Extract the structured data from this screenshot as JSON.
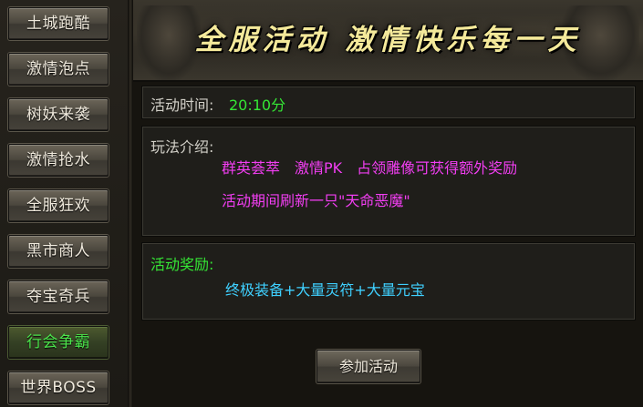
{
  "menu": {
    "items": [
      {
        "label": "土城跑酷",
        "active": false
      },
      {
        "label": "激情泡点",
        "active": false
      },
      {
        "label": "树妖来袭",
        "active": false
      },
      {
        "label": "激情抢水",
        "active": false
      },
      {
        "label": "全服狂欢",
        "active": false
      },
      {
        "label": "黑市商人",
        "active": false
      },
      {
        "label": "夺宝奇兵",
        "active": false
      },
      {
        "label": "行会争霸",
        "active": true
      },
      {
        "label": "世界BOSS",
        "active": false
      }
    ]
  },
  "banner": {
    "title": "全服活动 激情快乐每一天"
  },
  "activity_time": {
    "label": "活动时间:",
    "value": "20:10分"
  },
  "gameplay_intro": {
    "label": "玩法介绍:",
    "line1": "群英荟萃　激情PK　占领雕像可获得额外奖励",
    "line2": "活动期间刷新一只\"天命恶魔\""
  },
  "rewards": {
    "label": "活动奖励:",
    "value": "终极装备+大量灵符+大量元宝"
  },
  "join_button": {
    "label": "参加活动"
  },
  "colors": {
    "active_menu_text": "#35e635",
    "time_value": "#35e635",
    "intro_text": "#f23ef2",
    "reward_label": "#35e635",
    "reward_text": "#3fd0ff",
    "banner_title": "#f4e99a"
  }
}
